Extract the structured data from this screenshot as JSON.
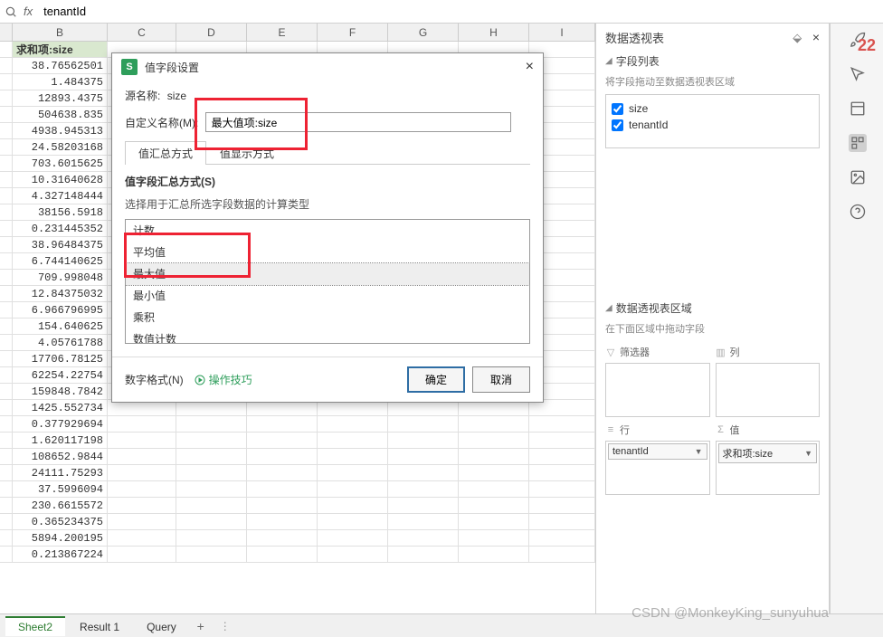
{
  "formula": {
    "value": "tenantId",
    "fx": "fx"
  },
  "columns": [
    "B",
    "C",
    "D",
    "E",
    "F",
    "G",
    "H",
    "I"
  ],
  "header_cell": "求和项:size",
  "cells": [
    "38.76562501",
    "1.484375",
    "12893.4375",
    "504638.835",
    "4938.945313",
    "24.58203168",
    "703.6015625",
    "10.31640628",
    "4.327148444",
    "38156.5918",
    "0.231445352",
    "38.96484375",
    "6.744140625",
    "709.998048",
    "12.84375032",
    "6.966796995",
    "154.640625",
    "4.05761788",
    "17706.78125",
    "62254.22754",
    "159848.7842",
    "1425.552734",
    "0.377929694",
    "1.620117198",
    "108652.9844",
    "24111.75293",
    "37.5996094",
    "230.6615572",
    "0.365234375",
    "5894.200195",
    "0.213867224"
  ],
  "sheets": {
    "active": "Sheet2",
    "tabs": [
      "Sheet2",
      "Result 1",
      "Query"
    ]
  },
  "pivot_panel": {
    "title": "数据透视表",
    "field_list": "字段列表",
    "field_hint": "将字段拖动至数据透视表区域",
    "fields": [
      "size",
      "tenantId"
    ],
    "area_title": "数据透视表区域",
    "area_hint": "在下面区域中拖动字段",
    "filter": "筛选器",
    "column": "列",
    "row": "行",
    "value": "值",
    "row_chip": "tenantId",
    "value_chip": "求和项:size"
  },
  "dialog": {
    "title": "值字段设置",
    "source_label": "源名称:",
    "source_value": "size",
    "custom_label": "自定义名称(M):",
    "custom_value": "最大值项:size",
    "tab1": "值汇总方式",
    "tab2": "值显示方式",
    "sub": "值字段汇总方式(S)",
    "hint": "选择用于汇总所选字段数据的计算类型",
    "options": [
      "计数",
      "平均值",
      "最大值",
      "最小值",
      "乘积",
      "数值计数"
    ],
    "selected_option": "最大值",
    "numfmt": "数字格式(N)",
    "tips": "操作技巧",
    "ok": "确定",
    "cancel": "取消"
  },
  "watermark": "CSDN @MonkeyKing_sunyuhua",
  "rail_badge": "22"
}
